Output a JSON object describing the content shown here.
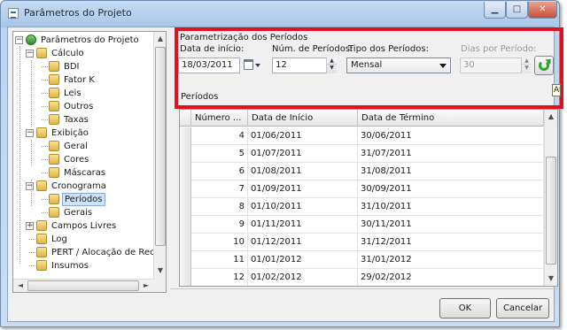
{
  "window": {
    "title": "Parâmetros do Projeto",
    "min_glyph": "▁",
    "max_glyph": "□",
    "close_glyph": "✕"
  },
  "tree": {
    "items": [
      {
        "label": "Parâmetros do Projeto",
        "level": 0,
        "expander": "−",
        "icon": "root-icon"
      },
      {
        "label": "Cálculo",
        "level": 1,
        "expander": "−",
        "icon": "folder-icon"
      },
      {
        "label": "BDI",
        "level": 2,
        "expander": "",
        "icon": "folder-icon"
      },
      {
        "label": "Fator K",
        "level": 2,
        "expander": "",
        "icon": "folder-icon"
      },
      {
        "label": "Leis",
        "level": 2,
        "expander": "",
        "icon": "folder-icon"
      },
      {
        "label": "Outros",
        "level": 2,
        "expander": "",
        "icon": "folder-icon"
      },
      {
        "label": "Taxas",
        "level": 2,
        "expander": "",
        "icon": "folder-icon"
      },
      {
        "label": "Exibição",
        "level": 1,
        "expander": "−",
        "icon": "folder-icon"
      },
      {
        "label": "Geral",
        "level": 2,
        "expander": "",
        "icon": "folder-icon"
      },
      {
        "label": "Cores",
        "level": 2,
        "expander": "",
        "icon": "folder-icon"
      },
      {
        "label": "Máscaras",
        "level": 2,
        "expander": "",
        "icon": "folder-icon"
      },
      {
        "label": "Cronograma",
        "level": 1,
        "expander": "−",
        "icon": "folder-icon"
      },
      {
        "label": "Períodos",
        "level": 2,
        "expander": "",
        "icon": "folder-icon",
        "selected": true
      },
      {
        "label": "Gerais",
        "level": 2,
        "expander": "",
        "icon": "folder-icon"
      },
      {
        "label": "Campos Livres",
        "level": 1,
        "expander": "+",
        "icon": "folder-icon"
      },
      {
        "label": "Log",
        "level": 1,
        "expander": "",
        "icon": "folder-icon"
      },
      {
        "label": "PERT / Alocação de Recur",
        "level": 1,
        "expander": "",
        "icon": "folder-icon"
      },
      {
        "label": "Insumos",
        "level": 1,
        "expander": "",
        "icon": "folder-icon"
      }
    ],
    "scroll_up": "▲",
    "scroll_down": "▼",
    "scroll_left": "◄",
    "scroll_right": "►"
  },
  "params": {
    "group_title": "Parametrização dos Períodos",
    "start_date_label": "Data de início:",
    "start_date_value": "18/03/2011",
    "num_periods_label": "Núm. de Períodos:",
    "num_periods_value": "12",
    "period_type_label": "Tipo dos Períodos:",
    "period_type_value": "Mensal",
    "days_per_period_label": "Dias por Período:",
    "days_per_period_value": "30",
    "spin_up": "▲",
    "spin_down": "▼",
    "tooltip_fragment": "Atu"
  },
  "periods": {
    "label": "Períodos",
    "columns": [
      "Número ...",
      "Data de Início",
      "Data de Término"
    ],
    "rows": [
      {
        "num": "4",
        "start": "01/06/2011",
        "end": "30/06/2011"
      },
      {
        "num": "5",
        "start": "01/07/2011",
        "end": "31/07/2011"
      },
      {
        "num": "6",
        "start": "01/08/2011",
        "end": "31/08/2011"
      },
      {
        "num": "7",
        "start": "01/09/2011",
        "end": "30/09/2011"
      },
      {
        "num": "8",
        "start": "01/10/2011",
        "end": "31/10/2011"
      },
      {
        "num": "9",
        "start": "01/11/2011",
        "end": "30/11/2011"
      },
      {
        "num": "10",
        "start": "01/12/2011",
        "end": "31/12/2011"
      },
      {
        "num": "11",
        "start": "01/01/2012",
        "end": "31/01/2012"
      },
      {
        "num": "12",
        "start": "01/02/2012",
        "end": "29/02/2012"
      }
    ],
    "scroll_up": "▲",
    "scroll_down": "▼"
  },
  "buttons": {
    "ok": "OK",
    "cancel": "Cancelar"
  },
  "colors": {
    "highlight_border": "#e0121d",
    "selected_tree_bg": "#cfe3fb",
    "refresh_green": "#2ea42a"
  }
}
